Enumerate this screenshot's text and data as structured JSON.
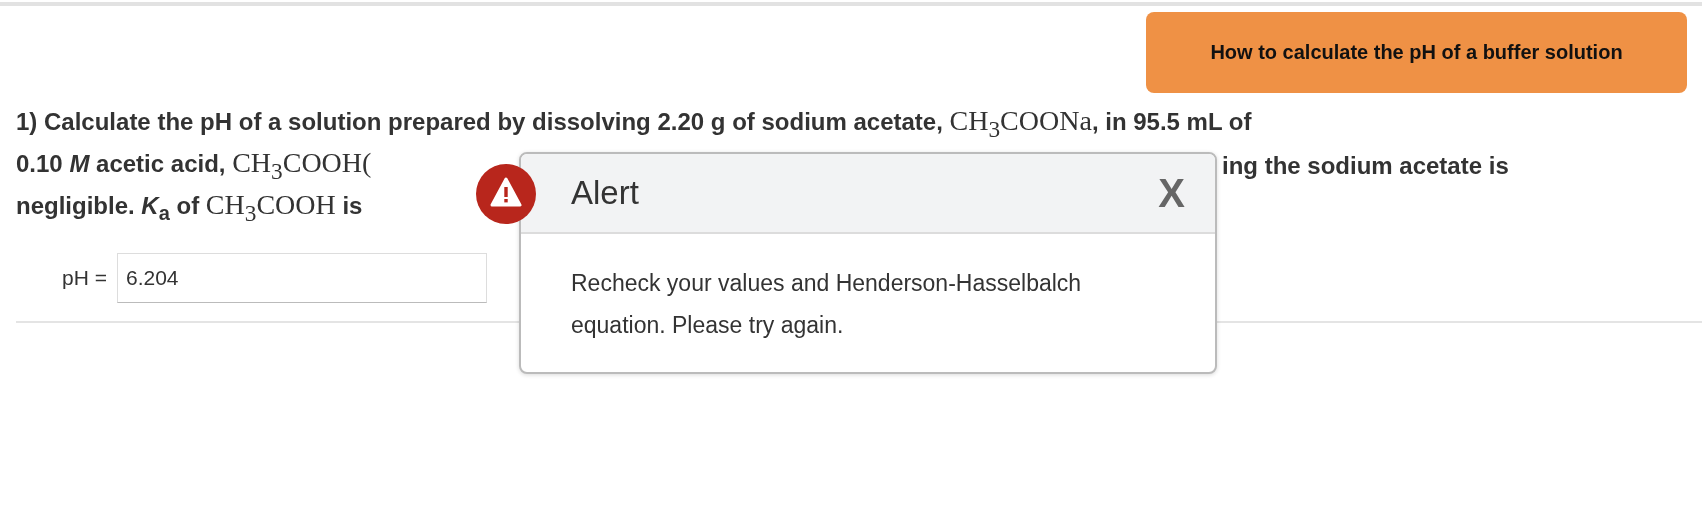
{
  "help_button": {
    "label": "How to calculate the pH of a buffer solution"
  },
  "question": {
    "lines": [
      [
        {
          "kind": "text",
          "text": "1) Calculate the pH of a solution prepared by dissolving 2.20 g of sodium acetate, "
        },
        {
          "kind": "math",
          "text": "CH$_{3}$COONa"
        },
        {
          "kind": "text",
          "text": ", in 95.5 mL of"
        }
      ],
      [
        {
          "kind": "text",
          "text": "0.10 *M* acetic acid, "
        },
        {
          "kind": "math",
          "text": "CH$_{3}$COOH("
        }
      ],
      [
        {
          "kind": "text",
          "text": "ing the sodium acetate is"
        }
      ],
      [
        {
          "kind": "text",
          "text": "negligible. *K*$_{a}$ of "
        },
        {
          "kind": "math",
          "text": "CH$_{3}$COOH"
        },
        {
          "kind": "text",
          "text": " is"
        }
      ]
    ]
  },
  "answer": {
    "label": "pH =",
    "value": "6.204"
  },
  "alert": {
    "title": "Alert",
    "close": "X",
    "message": "Recheck your values and Henderson-Hasselbalch equation. Please try again."
  }
}
